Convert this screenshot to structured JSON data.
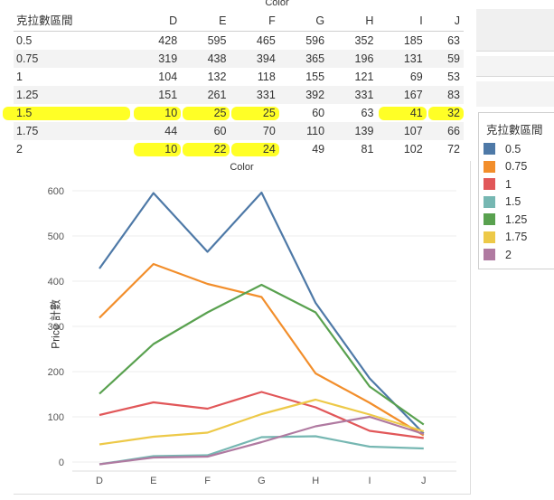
{
  "table": {
    "title": "Color",
    "row_header": "克拉數區間",
    "columns": [
      "D",
      "E",
      "F",
      "G",
      "H",
      "I",
      "J"
    ],
    "rows": [
      {
        "label": "0.5",
        "values": [
          428,
          595,
          465,
          596,
          352,
          185,
          63
        ]
      },
      {
        "label": "0.75",
        "values": [
          319,
          438,
          394,
          365,
          196,
          131,
          59
        ]
      },
      {
        "label": "1",
        "values": [
          104,
          132,
          118,
          155,
          121,
          69,
          53
        ]
      },
      {
        "label": "1.25",
        "values": [
          151,
          261,
          331,
          392,
          331,
          167,
          83
        ]
      },
      {
        "label": "1.5",
        "values": [
          10,
          25,
          25,
          60,
          63,
          41,
          32
        ]
      },
      {
        "label": "1.75",
        "values": [
          44,
          60,
          70,
          110,
          139,
          107,
          66
        ]
      },
      {
        "label": "2",
        "values": [
          10,
          22,
          24,
          49,
          81,
          102,
          72
        ]
      }
    ],
    "highlighted_cells": [
      {
        "row": "1.5",
        "col": "D"
      },
      {
        "row": "1.5",
        "col": "E"
      },
      {
        "row": "1.5",
        "col": "F"
      },
      {
        "row": "1.5",
        "col": "I"
      },
      {
        "row": "1.5",
        "col": "J"
      },
      {
        "row": "1.75",
        "col": "D"
      },
      {
        "row": "2",
        "col": "D"
      },
      {
        "row": "2",
        "col": "E"
      },
      {
        "row": "2",
        "col": "F"
      }
    ],
    "highlight_color": "#ffff00"
  },
  "chart_data": {
    "type": "line",
    "title": "Color",
    "xlabel": "",
    "ylabel": "Price 計數",
    "categories": [
      "D",
      "E",
      "F",
      "G",
      "H",
      "I",
      "J"
    ],
    "yticks": [
      0,
      100,
      200,
      300,
      400,
      500,
      600
    ],
    "ylim": [
      0,
      620
    ],
    "grid": true,
    "series": [
      {
        "name": "0.5",
        "color": "#4e79a7",
        "values": [
          428,
          595,
          465,
          596,
          352,
          185,
          63
        ]
      },
      {
        "name": "0.75",
        "color": "#f28e2b",
        "values": [
          319,
          438,
          394,
          365,
          196,
          131,
          59
        ]
      },
      {
        "name": "1",
        "color": "#e15759",
        "values": [
          104,
          132,
          118,
          155,
          121,
          69,
          53
        ]
      },
      {
        "name": "1.25",
        "color": "#59a14f",
        "values": [
          151,
          261,
          331,
          392,
          331,
          167,
          83
        ]
      },
      {
        "name": "1.5",
        "color": "#76b7b2",
        "values": [
          -5,
          13,
          15,
          55,
          57,
          34,
          30
        ]
      },
      {
        "name": "1.75",
        "color": "#edc948",
        "values": [
          39,
          56,
          65,
          106,
          138,
          105,
          68
        ]
      },
      {
        "name": "2",
        "color": "#b07aa1",
        "values": [
          -5,
          10,
          12,
          44,
          79,
          100,
          62
        ]
      }
    ],
    "legend_position": "right"
  },
  "legend": {
    "title": "克拉數區間",
    "items": [
      {
        "label": "0.5",
        "color": "#4e79a7"
      },
      {
        "label": "0.75",
        "color": "#f28e2b"
      },
      {
        "label": "1",
        "color": "#e15759"
      },
      {
        "label": "1.5",
        "color": "#76b7b2"
      },
      {
        "label": "1.25",
        "color": "#59a14f"
      },
      {
        "label": "1.75",
        "color": "#edc948"
      },
      {
        "label": "2",
        "color": "#b07aa1"
      }
    ]
  }
}
